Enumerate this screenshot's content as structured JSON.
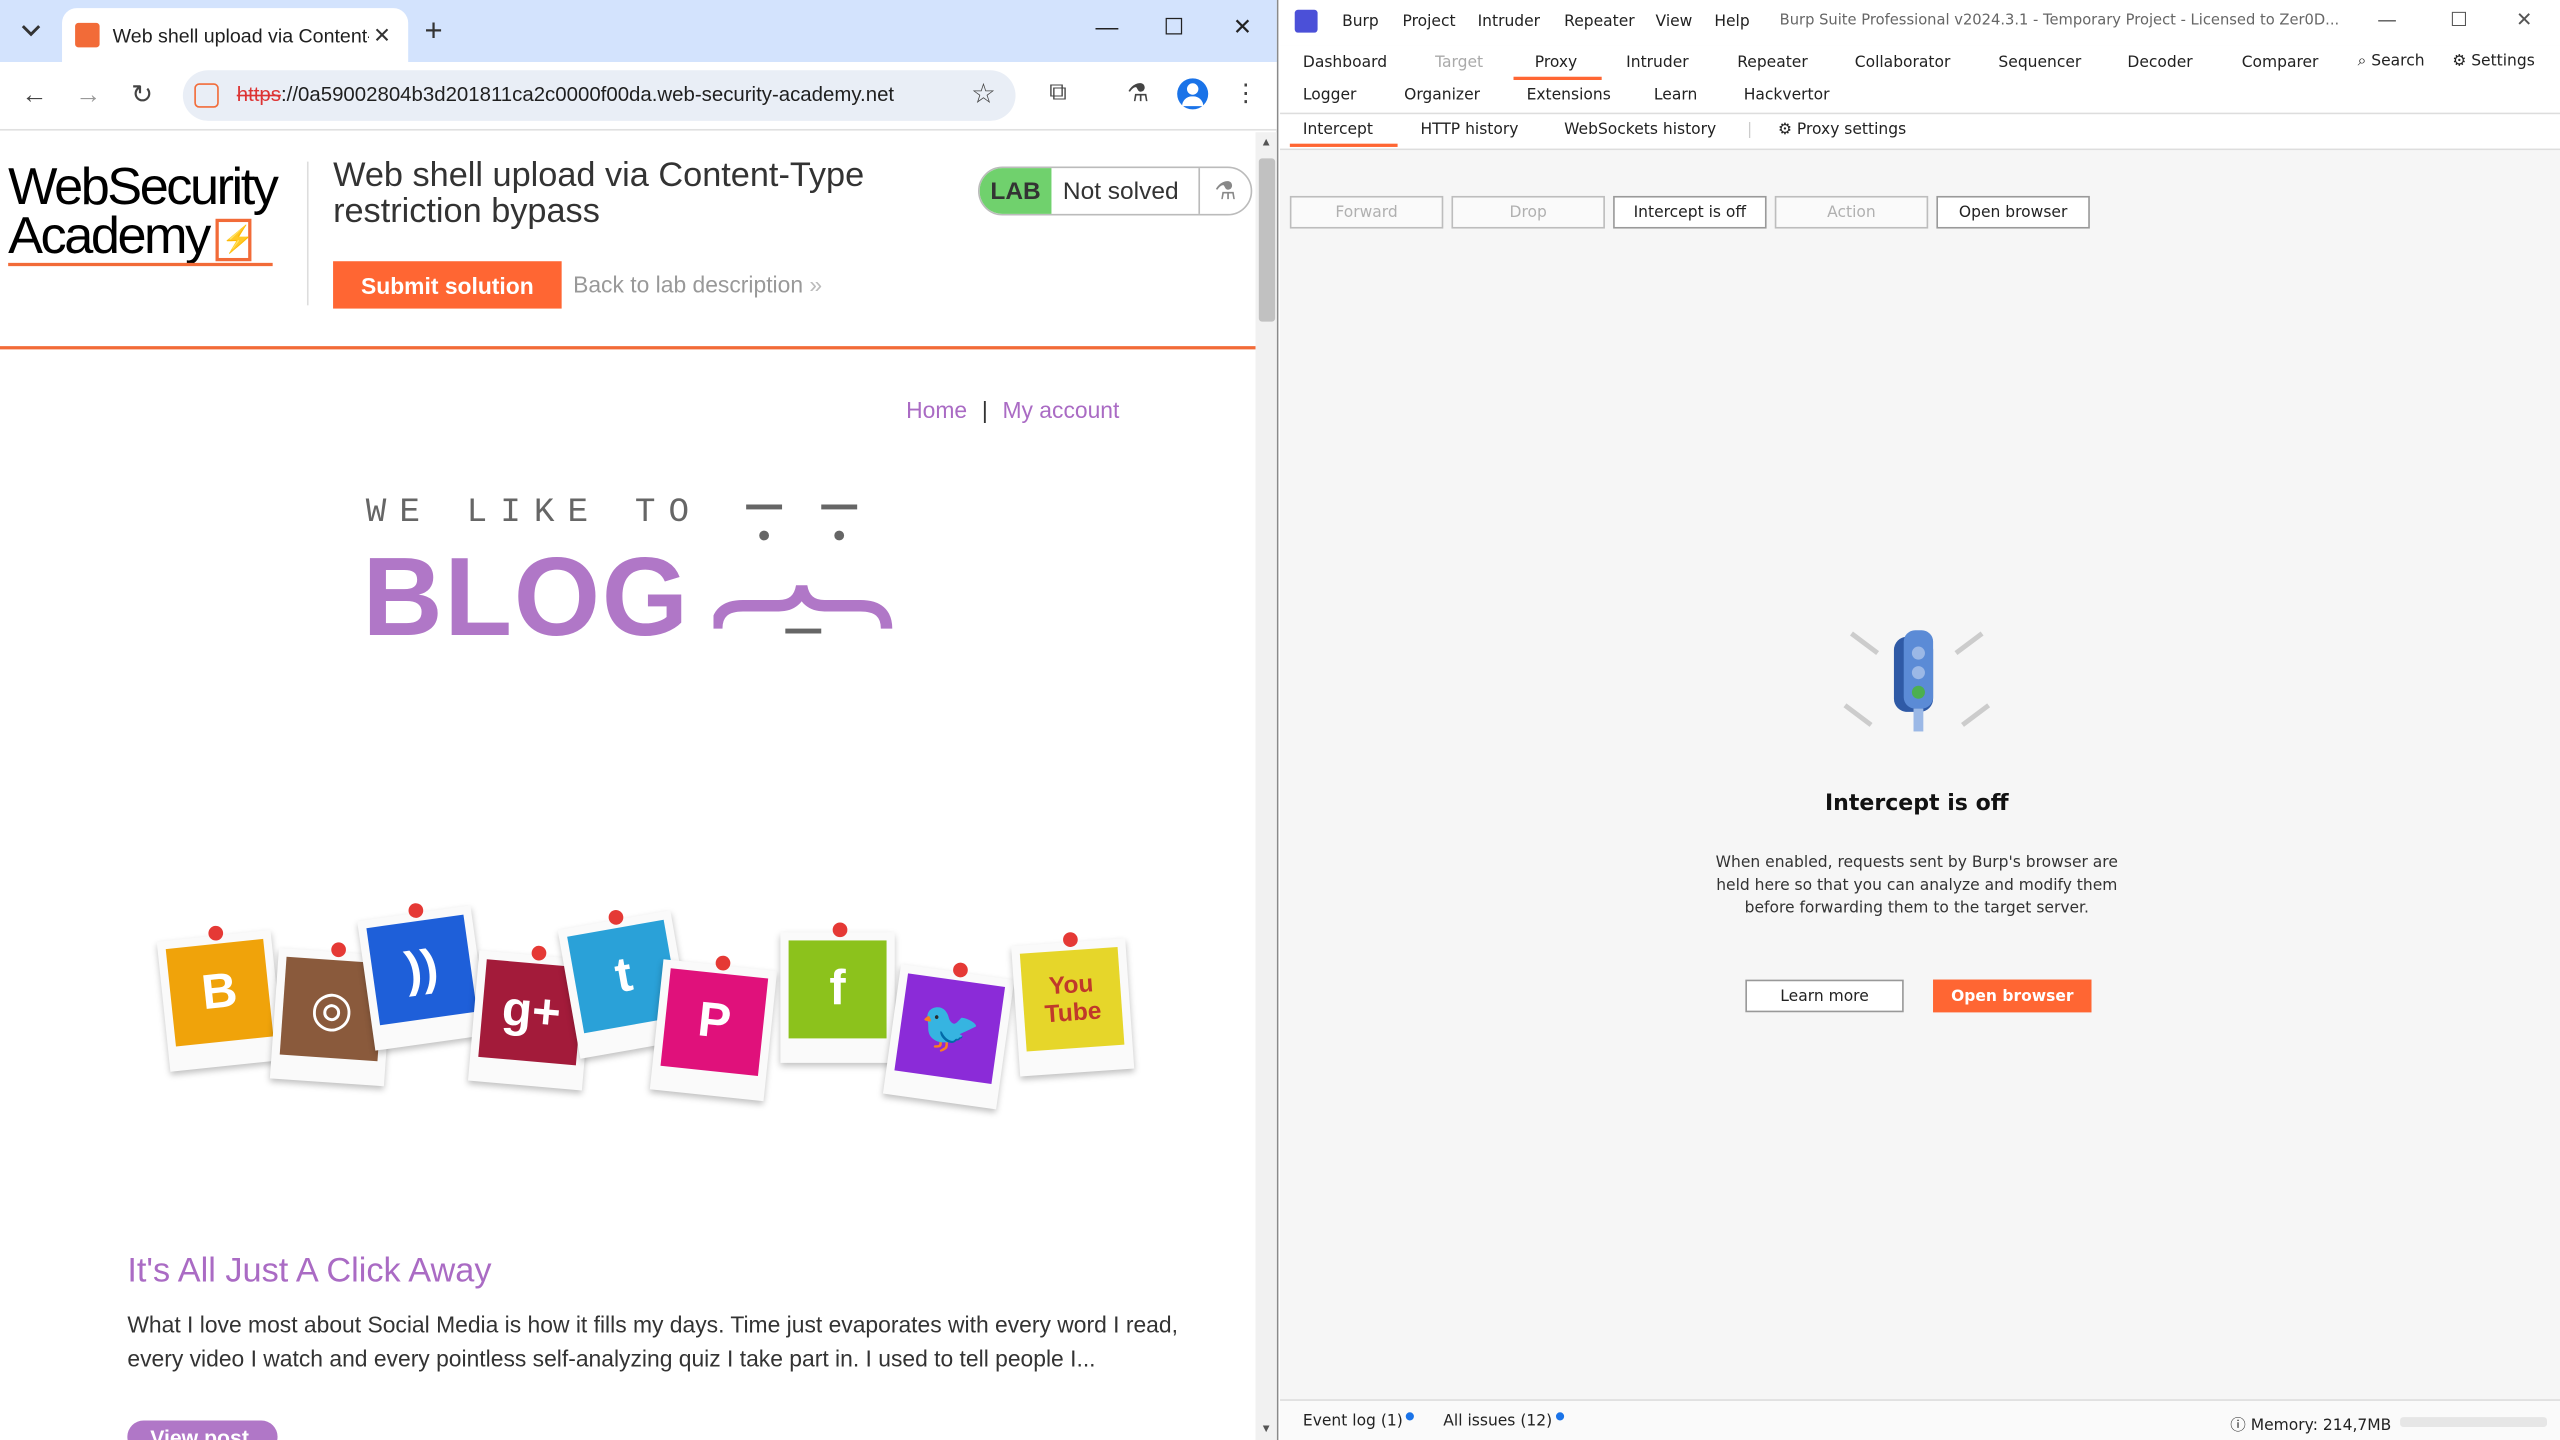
{
  "chrome": {
    "tab_title": "Web shell upload via Content-",
    "new_tab": "+",
    "url_scheme": "https",
    "url_rest": "://0a59002804b3d201811ca2c0000f00da.web-security-academy.net"
  },
  "lab": {
    "logo_line1": "WebSecurity",
    "logo_line2": "Academy",
    "title": "Web shell upload via Content-Type restriction bypass",
    "submit_label": "Submit solution",
    "back_label": "Back to lab description",
    "badge_lab": "LAB",
    "badge_status": "Not solved"
  },
  "site": {
    "nav_home": "Home",
    "nav_sep": "|",
    "nav_account": "My account",
    "brand_top": "WE LIKE TO",
    "brand_main": "BLOG",
    "post_title": "It's All Just A Click Away",
    "post_body": "What I love most about Social Media is how it fills my days. Time just evaporates with every word I read, every video I watch and every pointless self-analyzing quiz I take part in. I used to tell people I...",
    "view_post": "View post"
  },
  "social_tiles": [
    {
      "label": "blogger",
      "color": "#f0a30a"
    },
    {
      "label": "instagram",
      "color": "#8a5a3c"
    },
    {
      "label": "rss",
      "color": "#1e5fd9"
    },
    {
      "label": "g+",
      "color": "#a31b3a"
    },
    {
      "label": "t",
      "color": "#2aa1d8"
    },
    {
      "label": "pinterest",
      "color": "#e0117b"
    },
    {
      "label": "f",
      "color": "#8cc21c"
    },
    {
      "label": "twitter",
      "color": "#8b2bd8"
    },
    {
      "label": "YouTube",
      "color": "#e6d62a"
    }
  ],
  "burp": {
    "menus": [
      "Burp",
      "Project",
      "Intruder",
      "Repeater",
      "View",
      "Help"
    ],
    "app_title": "Burp Suite Professional v2024.3.1 - Temporary Project - Licensed to Zer0D...",
    "tabs_row1": [
      "Dashboard",
      "Target",
      "Proxy",
      "Intruder",
      "Repeater",
      "Collaborator",
      "Sequencer",
      "Decoder",
      "Comparer"
    ],
    "tabs_row2": [
      "Logger",
      "Organizer",
      "Extensions",
      "Learn",
      "Hackvertor"
    ],
    "search_label": "Search",
    "settings_label": "Settings",
    "subtabs": [
      "Intercept",
      "HTTP history",
      "WebSockets history"
    ],
    "proxy_settings": "Proxy settings",
    "buttons": {
      "forward": "Forward",
      "drop": "Drop",
      "intercept": "Intercept is off",
      "action": "Action",
      "open_browser": "Open browser"
    },
    "empty_title": "Intercept is off",
    "empty_desc": "When enabled, requests sent by Burp's browser are held here so that you can analyze and modify them before forwarding them to the target server.",
    "learn_more": "Learn more",
    "open_browser": "Open browser",
    "event_log": "Event log (1)",
    "all_issues": "All issues (12)",
    "memory": "Memory: 214,7MB"
  },
  "colors": {
    "accent": "#ff6633",
    "purple": "#b077c7",
    "burp_brand": "#4b50d8"
  }
}
